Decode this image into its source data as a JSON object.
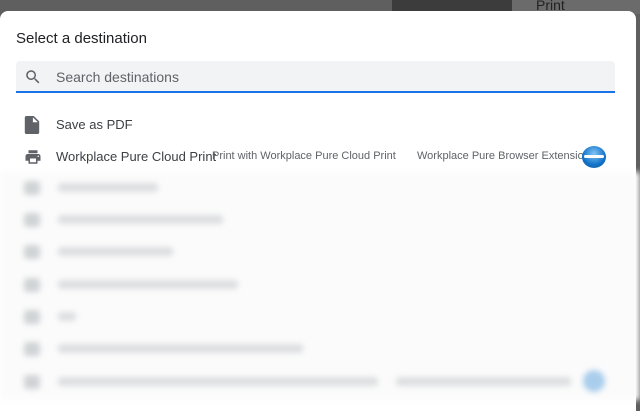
{
  "background": {
    "partial_label": "Print"
  },
  "dialog": {
    "title": "Select a destination",
    "search": {
      "placeholder": "Search destinations",
      "value": ""
    },
    "destinations": [
      {
        "name": "Save as PDF",
        "icon": "file-icon"
      },
      {
        "name": "Workplace Pure Cloud Print",
        "description": "Print with Workplace Pure Cloud Print",
        "extension": "Workplace Pure Browser Extension",
        "icon": "printer-icon"
      }
    ],
    "blurred_rows": 7
  },
  "colors": {
    "accent": "#1a73e8",
    "icon": "#5f6368",
    "text": "#3c4043"
  }
}
